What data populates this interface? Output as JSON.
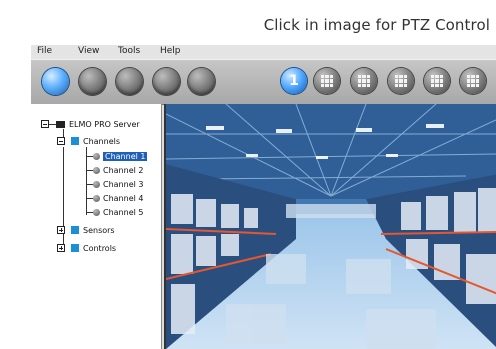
{
  "caption": "Click in image for PTZ Control",
  "menu": {
    "file": "File",
    "view": "View",
    "tools": "Tools",
    "help": "Help"
  },
  "toolbar": {
    "single_layout_label": "1"
  },
  "tree": {
    "server": "ELMO PRO Server",
    "channels": "Channels",
    "channel_items": [
      "Channel 1",
      "Channel 2",
      "Channel 3",
      "Channel 4",
      "Channel 5"
    ],
    "sensors": "Sensors",
    "controls": "Controls"
  },
  "colors": {
    "selection": "#1f5fb8",
    "tree_square": "#1a8fd6",
    "active_button": "#4aa4ff"
  }
}
